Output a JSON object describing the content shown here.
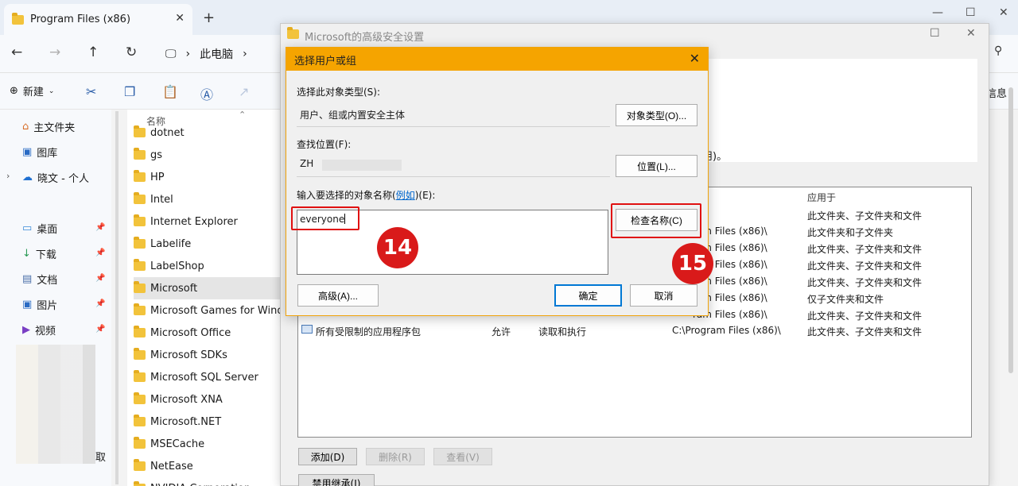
{
  "explorer": {
    "tab_title": "Program Files (x86)",
    "new_tab": "+",
    "breadcrumb": {
      "sep": "›",
      "item1": "此电脑",
      "sep2": "›"
    },
    "cmd": {
      "new_label": "新建",
      "details_label": "信息"
    },
    "nav_items": [
      "主文件夹",
      "图库",
      "晓文 - 个人",
      "桌面",
      "下载",
      "文档",
      "图片",
      "视频"
    ],
    "column_name": "名称",
    "files": [
      "dotnet",
      "gs",
      "HP",
      "Intel",
      "Internet Explorer",
      "Labelife",
      "LabelShop",
      "Microsoft",
      "Microsoft Games for Windows",
      "Microsoft Office",
      "Microsoft SDKs",
      "Microsoft SQL Server",
      "Microsoft XNA",
      "Microsoft.NET",
      "MSECache",
      "NetEase",
      "NVIDIA Corporation"
    ],
    "selected_file": "Microsoft",
    "side_text": "取"
  },
  "security": {
    "title": "Microsoft的高级安全设置",
    "note": "用)。",
    "col_applies": "应用于",
    "rows": [
      {
        "path": "",
        "applies": "此文件夹、子文件夹和文件"
      },
      {
        "path": "ram Files (x86)\\",
        "applies": "此文件夹和子文件夹"
      },
      {
        "path": "ram Files (x86)\\",
        "applies": "此文件夹、子文件夹和文件"
      },
      {
        "path": "ram Files (x86)\\",
        "applies": "此文件夹、子文件夹和文件"
      },
      {
        "path": "ram Files (x86)\\",
        "applies": "此文件夹、子文件夹和文件"
      },
      {
        "path": "ram Files (x86)\\",
        "applies": "仅子文件夹和文件"
      },
      {
        "path": "ram Files (x86)\\",
        "applies": "此文件夹、子文件夹和文件"
      }
    ],
    "last_row": {
      "name": "所有受限制的应用程序包",
      "type": "允许",
      "access": "读取和执行",
      "path": "C:\\Program Files (x86)\\",
      "applies": "此文件夹、子文件夹和文件"
    },
    "buttons": {
      "add": "添加(D)",
      "remove": "删除(R)",
      "view": "查看(V)",
      "disable_inherit": "禁用继承(I)"
    }
  },
  "dialog": {
    "title": "选择用户或组",
    "object_type_label": "选择此对象类型(S):",
    "object_type_value": "用户、组或内置安全主体",
    "object_type_button": "对象类型(O)...",
    "location_label": "查找位置(F):",
    "location_value": "ZH",
    "location_button": "位置(L)...",
    "names_label_prefix": "输入要选择的对象名称(",
    "names_label_link": "例如",
    "names_label_suffix": ")(E):",
    "names_value": "everyone",
    "check_names_button": "检查名称(C)",
    "advanced_button": "高级(A)...",
    "ok_button": "确定",
    "cancel_button": "取消"
  },
  "annotations": {
    "step1": "14",
    "step2": "15",
    "highlight_color": "#e01010",
    "badge_color": "#d91a1a"
  },
  "colors": {
    "dialog_title": "#f5a400",
    "folder": "#f2c33b",
    "accent": "#0078d4"
  }
}
